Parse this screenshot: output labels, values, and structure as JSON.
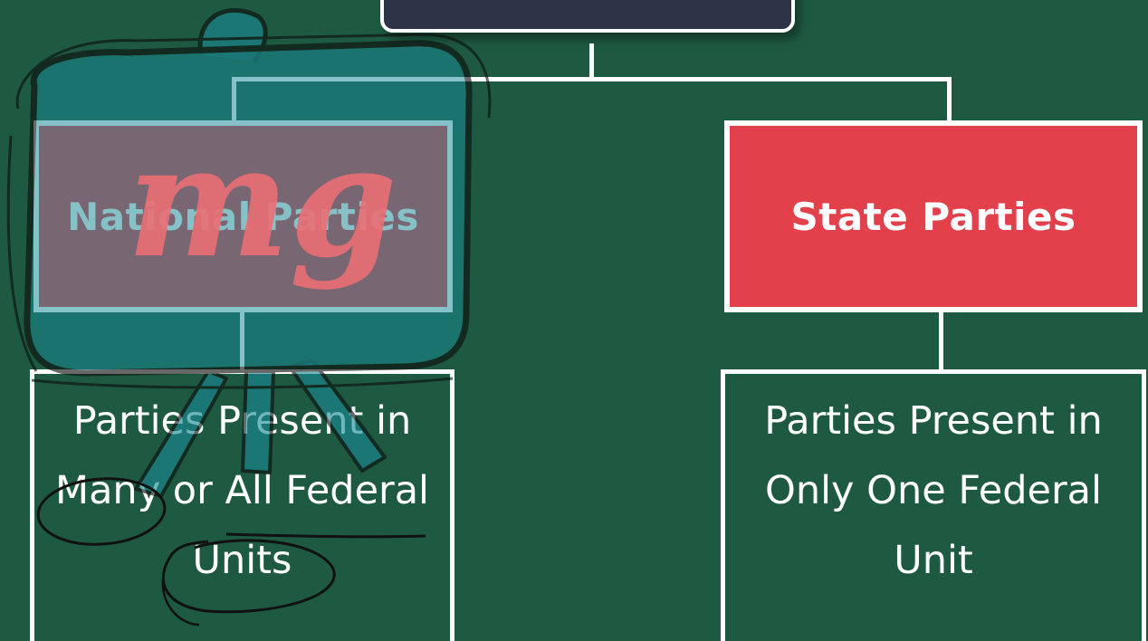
{
  "diagram": {
    "nodes": {
      "national": {
        "title": "National Parties",
        "desc_lines": [
          "Parties Present in",
          "Many or All Federal",
          "Units"
        ]
      },
      "state": {
        "title": "State Parties",
        "desc_lines": [
          "Parties Present in",
          "Only One Federal",
          "Unit"
        ]
      }
    }
  },
  "watermark": {
    "text": "mg",
    "icon": "easel-board-icon"
  },
  "colors": {
    "background": "#1e5a42",
    "box_red": "#e2404a",
    "top_box": "#2d3448",
    "watermark_teal": "#1a8a96",
    "watermark_pink": "#ea6f74",
    "ink": "#111111"
  }
}
